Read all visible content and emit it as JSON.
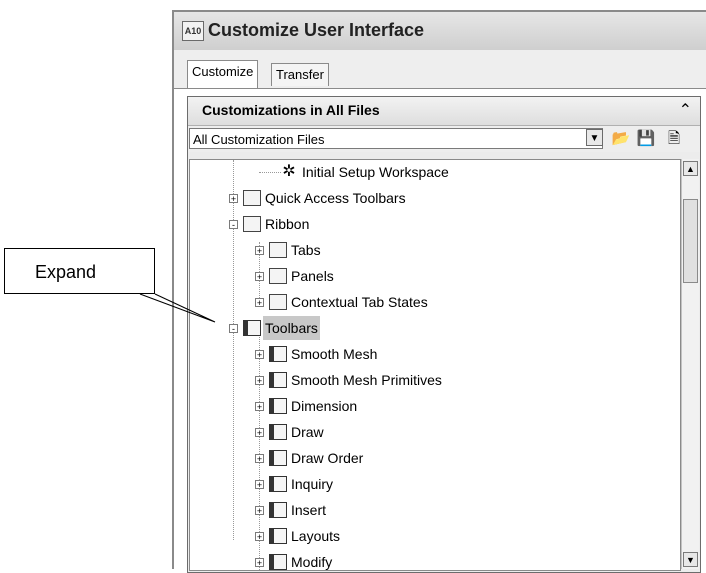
{
  "window": {
    "app_icon": "A10",
    "title": "Customize User Interface"
  },
  "tabs": [
    {
      "label": "Customize",
      "active": true
    },
    {
      "label": "Transfer",
      "active": false
    }
  ],
  "panel": {
    "title": "Customizations in All Files",
    "collapse_icon": "double-chevron-up-icon",
    "filter_value": "All Customization Files"
  },
  "tree": [
    {
      "label": "Initial Setup Workspace",
      "icon": "gear-icon",
      "expander": "",
      "selected": false
    },
    {
      "label": "Quick Access Toolbars",
      "icon": "quick-access-toolbar-icon",
      "expander": "+",
      "selected": false
    },
    {
      "label": "Ribbon",
      "icon": "folder-icon",
      "expander": "-",
      "selected": false
    },
    {
      "label": "Tabs",
      "icon": "tab-icon",
      "expander": "+",
      "selected": false
    },
    {
      "label": "Panels",
      "icon": "panel-icon",
      "expander": "+",
      "selected": false
    },
    {
      "label": "Contextual Tab States",
      "icon": "contextual-tab-icon",
      "expander": "+",
      "selected": false
    },
    {
      "label": "Toolbars",
      "icon": "toolbars-icon",
      "expander": "-",
      "selected": true
    },
    {
      "label": "Smooth Mesh",
      "icon": "toolbar-icon",
      "expander": "+",
      "selected": false
    },
    {
      "label": "Smooth Mesh Primitives",
      "icon": "toolbar-icon",
      "expander": "+",
      "selected": false
    },
    {
      "label": "Dimension",
      "icon": "toolbar-icon",
      "expander": "+",
      "selected": false
    },
    {
      "label": "Draw",
      "icon": "toolbar-icon",
      "expander": "+",
      "selected": false
    },
    {
      "label": "Draw Order",
      "icon": "toolbar-icon",
      "expander": "+",
      "selected": false
    },
    {
      "label": "Inquiry",
      "icon": "toolbar-icon",
      "expander": "+",
      "selected": false
    },
    {
      "label": "Insert",
      "icon": "toolbar-icon",
      "expander": "+",
      "selected": false
    },
    {
      "label": "Layouts",
      "icon": "toolbar-icon",
      "expander": "+",
      "selected": false
    },
    {
      "label": "Modify",
      "icon": "toolbar-icon",
      "expander": "+",
      "selected": false
    }
  ],
  "callout": {
    "label": "Expand"
  }
}
